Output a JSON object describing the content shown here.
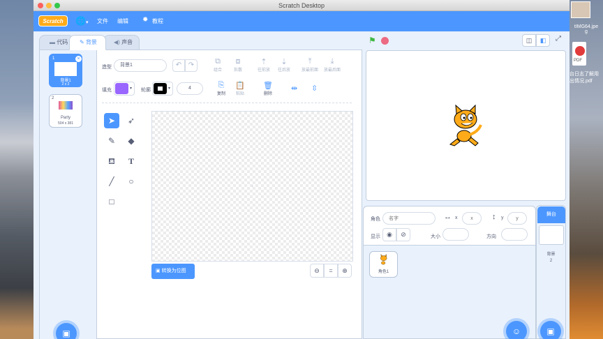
{
  "window": {
    "title": "Scratch Desktop"
  },
  "menubar": {
    "logo": "Scratch",
    "file": "文件",
    "edit": "编辑",
    "tutorials": "教程"
  },
  "tabs": {
    "code": "代码",
    "backdrops": "背景",
    "sounds": "声音"
  },
  "backdrops": [
    {
      "index": "1",
      "name": "背景1",
      "size": "2 x 2"
    },
    {
      "index": "2",
      "name": "Party",
      "size": "504 x 381"
    }
  ],
  "paint": {
    "costume_label": "造型",
    "costume_name": "背景1",
    "group": "组合",
    "ungroup": "拆散",
    "forward": "往前放",
    "backward": "往后放",
    "front": "放最前面",
    "back": "放最后面",
    "fill_label": "填充",
    "outline_label": "轮廓",
    "outline_width": "4",
    "copy": "复制",
    "paste": "粘贴",
    "delete": "删除",
    "convert_bitmap": "转换为位图",
    "fill_color": "#9966ff",
    "outline_color": "#000000"
  },
  "sprite_info": {
    "sprite_label": "角色",
    "name_placeholder": "名字",
    "x_label": "x",
    "x_placeholder": "x",
    "y_label": "y",
    "y_placeholder": "y",
    "show_label": "显示",
    "size_label": "大小",
    "direction_label": "方向"
  },
  "sprites": [
    {
      "name": "角色1"
    }
  ],
  "stage_panel": {
    "title": "舞台",
    "backdrops_label": "背景",
    "backdrop_count": "2"
  },
  "desktop": {
    "file1": "tIMG64.jpe",
    "file1b": "g",
    "file2_ext": "PDF",
    "file2a": "台日志了解用",
    "file2b": "出情况.pdf"
  }
}
